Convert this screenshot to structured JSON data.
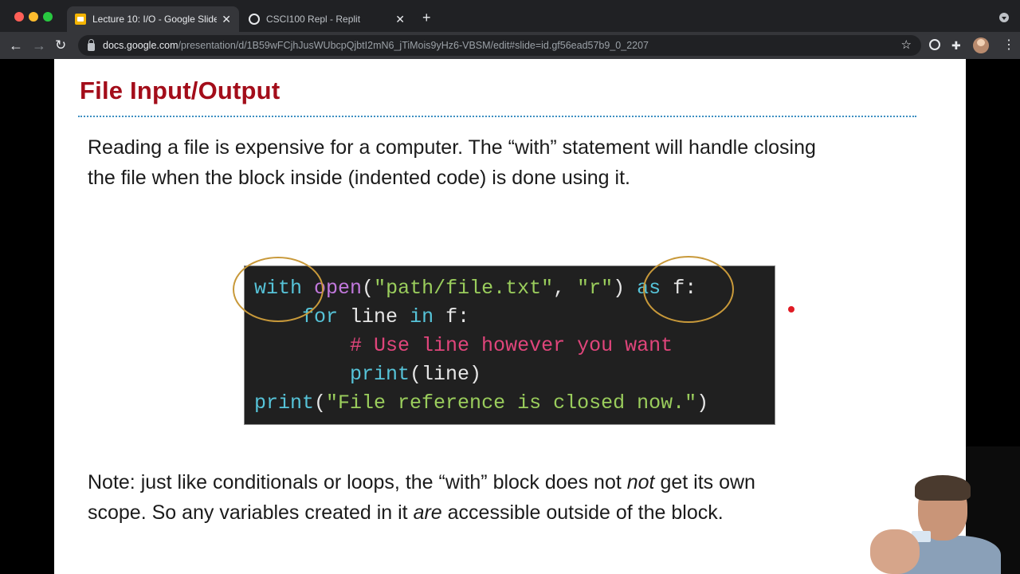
{
  "browser": {
    "tabs": [
      {
        "title": "Lecture 10: I/O - Google Slides",
        "active": true,
        "icon": "google-slides-icon"
      },
      {
        "title": "CSCI100 Repl - Replit",
        "active": false,
        "icon": "replit-icon"
      }
    ],
    "url_host": "docs.google.com",
    "url_path": "/presentation/d/1B59wFCjhJusWUbcpQjbtI2mN6_jTiMois9yHz6-VBSM/edit#slide=id.gf56ead57b9_0_2207"
  },
  "slide": {
    "title": "File Input/Output",
    "intro_line1": "Reading a file is expensive for a computer. The “with” statement will handle closing",
    "intro_line2": "the file when the block inside (indented code) is done using it.",
    "code": {
      "line1": {
        "kw_with": "with",
        "fn_open": "open",
        "paren_open": "(",
        "str_path": "\"path/file.txt\"",
        "comma": ", ",
        "str_mode": "\"r\"",
        "paren_close": ")",
        "kw_as": "as",
        "rest": "f:"
      },
      "line2": {
        "kw_for": "for",
        "mid": "line",
        "kw_in": "in",
        "rest": "f:"
      },
      "line3": {
        "comment": "# Use line however you want"
      },
      "line4": {
        "fn_print": "print",
        "rest": "(line)"
      },
      "line5": {
        "fn_print": "print",
        "paren_open": "(",
        "str_msg": "\"File reference is closed now.\"",
        "paren_close": ")"
      }
    },
    "note_part1": "Note: just like conditionals or loops, the “with” block does not ",
    "note_em1": "not",
    "note_part2": " get its own",
    "note_part3": "scope. So any variables created in it ",
    "note_em2": "are",
    "note_part4": " accessible outside of the block.",
    "annotation_color": "#c8993a"
  }
}
